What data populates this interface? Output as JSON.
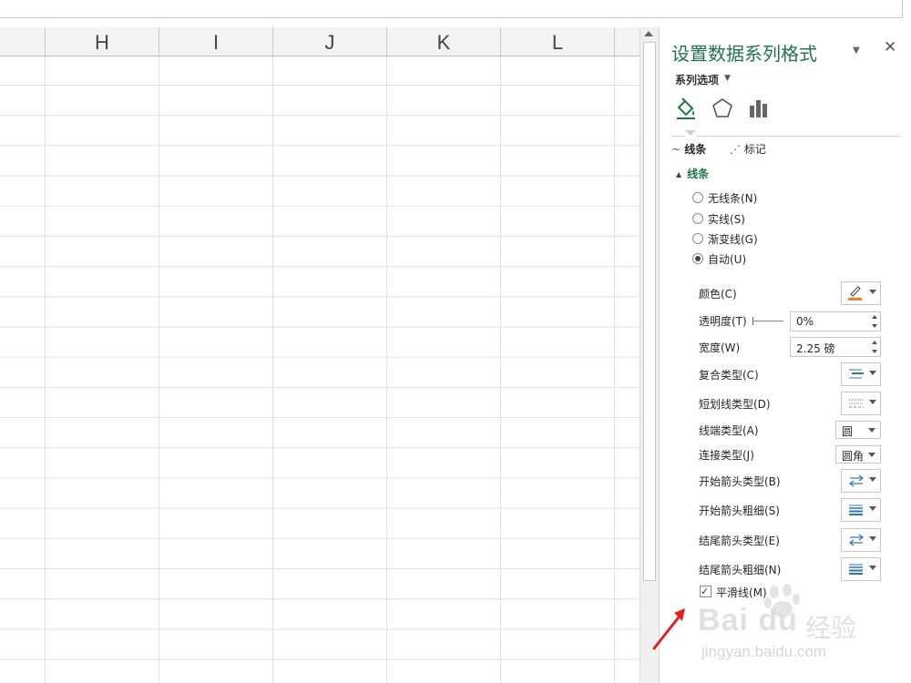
{
  "columns": [
    "H",
    "I",
    "J",
    "K",
    "L"
  ],
  "pane": {
    "title": "设置数据系列格式",
    "series_options": "系列选项",
    "subtabs": {
      "line": "线条",
      "marker": "标记"
    },
    "section": "线条",
    "radio_options": [
      {
        "label": "无线条(N)",
        "checked": false
      },
      {
        "label": "实线(S)",
        "checked": false
      },
      {
        "label": "渐变线(G)",
        "checked": false
      },
      {
        "label": "自动(U)",
        "checked": true
      }
    ],
    "props": {
      "color": "颜色(C)",
      "transparency": "透明度(T)",
      "transparency_value": "0%",
      "width": "宽度(W)",
      "width_value": "2.25 磅",
      "compound": "复合类型(C)",
      "dash": "短划线类型(D)",
      "cap": "线端类型(A)",
      "cap_value": "圆",
      "join": "连接类型(J)",
      "join_value": "圆角",
      "begin_arrow_type": "开始箭头类型(B)",
      "begin_arrow_size": "开始箭头粗细(S)",
      "end_arrow_type": "结尾箭头类型(E)",
      "end_arrow_size": "结尾箭头粗细(N)"
    },
    "smooth_line": {
      "label": "平滑线(M)",
      "checked": true
    }
  },
  "watermark": {
    "logo": "Bai du",
    "cn": "经验",
    "url": "jingyan.baidu.com"
  },
  "colors": {
    "accent": "#217346",
    "line_color_swatch": "#ed7d31",
    "annotation_arrow": "#e02020"
  }
}
